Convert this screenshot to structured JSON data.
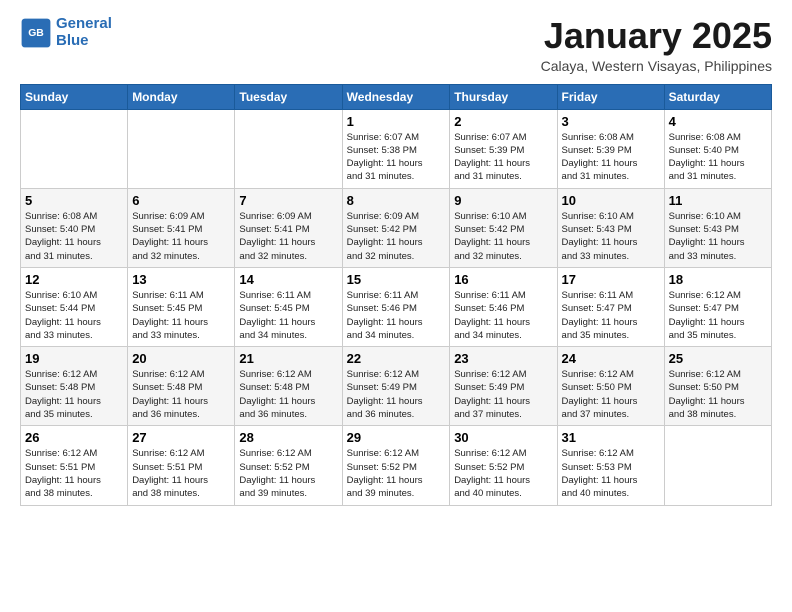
{
  "logo": {
    "line1": "General",
    "line2": "Blue"
  },
  "title": "January 2025",
  "subtitle": "Calaya, Western Visayas, Philippines",
  "weekdays": [
    "Sunday",
    "Monday",
    "Tuesday",
    "Wednesday",
    "Thursday",
    "Friday",
    "Saturday"
  ],
  "weeks": [
    [
      {
        "day": "",
        "info": ""
      },
      {
        "day": "",
        "info": ""
      },
      {
        "day": "",
        "info": ""
      },
      {
        "day": "1",
        "info": "Sunrise: 6:07 AM\nSunset: 5:38 PM\nDaylight: 11 hours\nand 31 minutes."
      },
      {
        "day": "2",
        "info": "Sunrise: 6:07 AM\nSunset: 5:39 PM\nDaylight: 11 hours\nand 31 minutes."
      },
      {
        "day": "3",
        "info": "Sunrise: 6:08 AM\nSunset: 5:39 PM\nDaylight: 11 hours\nand 31 minutes."
      },
      {
        "day": "4",
        "info": "Sunrise: 6:08 AM\nSunset: 5:40 PM\nDaylight: 11 hours\nand 31 minutes."
      }
    ],
    [
      {
        "day": "5",
        "info": "Sunrise: 6:08 AM\nSunset: 5:40 PM\nDaylight: 11 hours\nand 31 minutes."
      },
      {
        "day": "6",
        "info": "Sunrise: 6:09 AM\nSunset: 5:41 PM\nDaylight: 11 hours\nand 32 minutes."
      },
      {
        "day": "7",
        "info": "Sunrise: 6:09 AM\nSunset: 5:41 PM\nDaylight: 11 hours\nand 32 minutes."
      },
      {
        "day": "8",
        "info": "Sunrise: 6:09 AM\nSunset: 5:42 PM\nDaylight: 11 hours\nand 32 minutes."
      },
      {
        "day": "9",
        "info": "Sunrise: 6:10 AM\nSunset: 5:42 PM\nDaylight: 11 hours\nand 32 minutes."
      },
      {
        "day": "10",
        "info": "Sunrise: 6:10 AM\nSunset: 5:43 PM\nDaylight: 11 hours\nand 33 minutes."
      },
      {
        "day": "11",
        "info": "Sunrise: 6:10 AM\nSunset: 5:43 PM\nDaylight: 11 hours\nand 33 minutes."
      }
    ],
    [
      {
        "day": "12",
        "info": "Sunrise: 6:10 AM\nSunset: 5:44 PM\nDaylight: 11 hours\nand 33 minutes."
      },
      {
        "day": "13",
        "info": "Sunrise: 6:11 AM\nSunset: 5:45 PM\nDaylight: 11 hours\nand 33 minutes."
      },
      {
        "day": "14",
        "info": "Sunrise: 6:11 AM\nSunset: 5:45 PM\nDaylight: 11 hours\nand 34 minutes."
      },
      {
        "day": "15",
        "info": "Sunrise: 6:11 AM\nSunset: 5:46 PM\nDaylight: 11 hours\nand 34 minutes."
      },
      {
        "day": "16",
        "info": "Sunrise: 6:11 AM\nSunset: 5:46 PM\nDaylight: 11 hours\nand 34 minutes."
      },
      {
        "day": "17",
        "info": "Sunrise: 6:11 AM\nSunset: 5:47 PM\nDaylight: 11 hours\nand 35 minutes."
      },
      {
        "day": "18",
        "info": "Sunrise: 6:12 AM\nSunset: 5:47 PM\nDaylight: 11 hours\nand 35 minutes."
      }
    ],
    [
      {
        "day": "19",
        "info": "Sunrise: 6:12 AM\nSunset: 5:48 PM\nDaylight: 11 hours\nand 35 minutes."
      },
      {
        "day": "20",
        "info": "Sunrise: 6:12 AM\nSunset: 5:48 PM\nDaylight: 11 hours\nand 36 minutes."
      },
      {
        "day": "21",
        "info": "Sunrise: 6:12 AM\nSunset: 5:48 PM\nDaylight: 11 hours\nand 36 minutes."
      },
      {
        "day": "22",
        "info": "Sunrise: 6:12 AM\nSunset: 5:49 PM\nDaylight: 11 hours\nand 36 minutes."
      },
      {
        "day": "23",
        "info": "Sunrise: 6:12 AM\nSunset: 5:49 PM\nDaylight: 11 hours\nand 37 minutes."
      },
      {
        "day": "24",
        "info": "Sunrise: 6:12 AM\nSunset: 5:50 PM\nDaylight: 11 hours\nand 37 minutes."
      },
      {
        "day": "25",
        "info": "Sunrise: 6:12 AM\nSunset: 5:50 PM\nDaylight: 11 hours\nand 38 minutes."
      }
    ],
    [
      {
        "day": "26",
        "info": "Sunrise: 6:12 AM\nSunset: 5:51 PM\nDaylight: 11 hours\nand 38 minutes."
      },
      {
        "day": "27",
        "info": "Sunrise: 6:12 AM\nSunset: 5:51 PM\nDaylight: 11 hours\nand 38 minutes."
      },
      {
        "day": "28",
        "info": "Sunrise: 6:12 AM\nSunset: 5:52 PM\nDaylight: 11 hours\nand 39 minutes."
      },
      {
        "day": "29",
        "info": "Sunrise: 6:12 AM\nSunset: 5:52 PM\nDaylight: 11 hours\nand 39 minutes."
      },
      {
        "day": "30",
        "info": "Sunrise: 6:12 AM\nSunset: 5:52 PM\nDaylight: 11 hours\nand 40 minutes."
      },
      {
        "day": "31",
        "info": "Sunrise: 6:12 AM\nSunset: 5:53 PM\nDaylight: 11 hours\nand 40 minutes."
      },
      {
        "day": "",
        "info": ""
      }
    ]
  ]
}
